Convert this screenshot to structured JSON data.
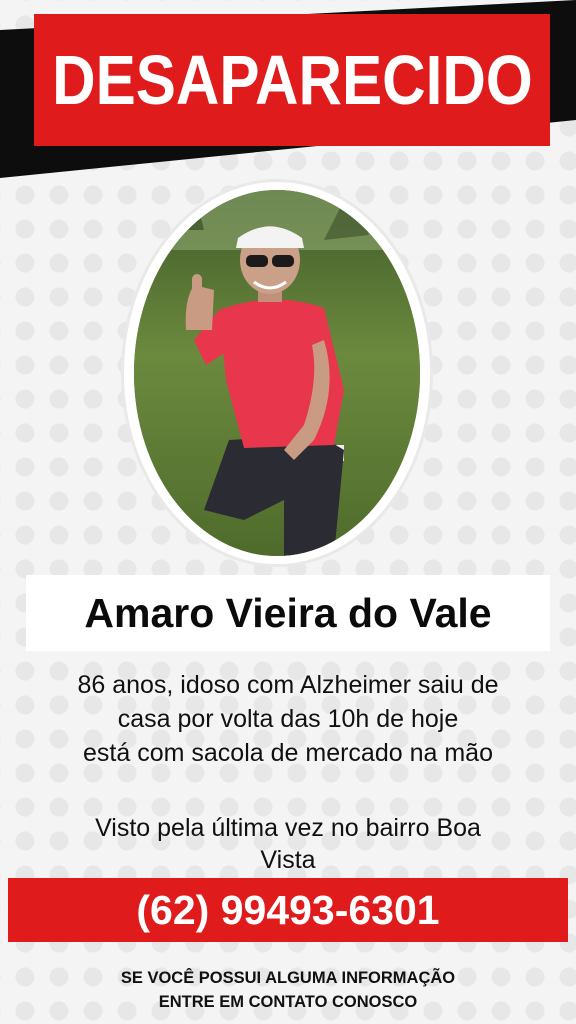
{
  "poster": {
    "title": "DESAPARECIDO",
    "name": "Amaro Vieira do Vale",
    "description_lines": [
      "86 anos, idoso com Alzheimer saiu de",
      "casa por volta das 10h de hoje",
      "está com sacola de mercado na mão"
    ],
    "last_seen_lines": [
      "Visto pela última vez no bairro Boa",
      "Vista"
    ],
    "phone": "(62) 99493-6301",
    "footer_lines": [
      "SE VOCÊ POSSUI ALGUMA INFORMAÇÃO",
      "ENTRE EM CONTATO CONOSCO"
    ]
  },
  "colors": {
    "accent_red": "#e01b1b",
    "band_black": "#0d0d0d",
    "text_dark": "#111111"
  }
}
